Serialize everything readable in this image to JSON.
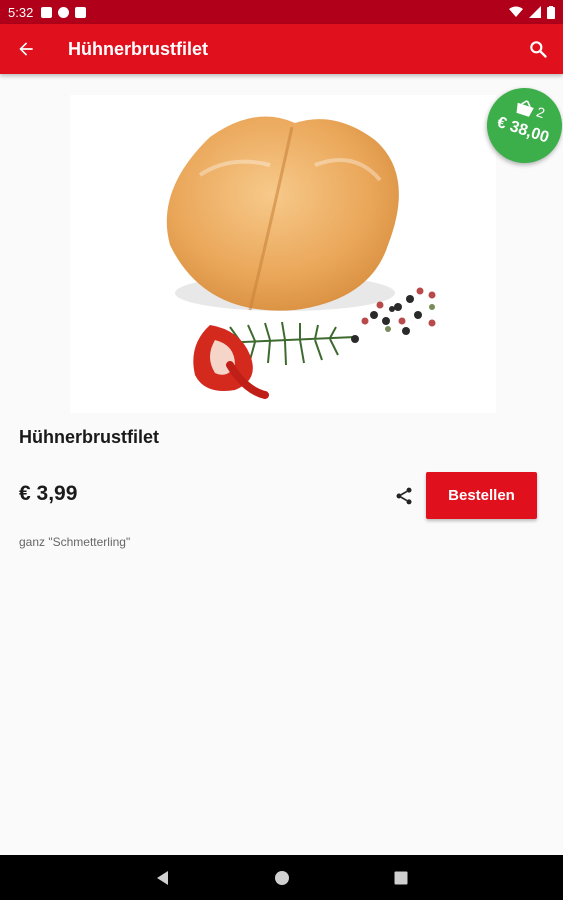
{
  "status_bar": {
    "time": "5:32"
  },
  "app_bar": {
    "title": "Hühnerbrustfilet"
  },
  "cart_badge": {
    "count": "2",
    "total": "€ 38,00"
  },
  "product": {
    "name": "Hühnerbrustfilet",
    "price": "€ 3,99",
    "order_label": "Bestellen",
    "description": "ganz \"Schmetterling\""
  },
  "icons": {
    "back": "arrow-back-icon",
    "search": "search-icon",
    "cart": "shopping-basket-icon",
    "share": "share-icon"
  },
  "colors": {
    "primary": "#e0101c",
    "status_bar": "#b0001a",
    "badge": "#3cae4a"
  }
}
